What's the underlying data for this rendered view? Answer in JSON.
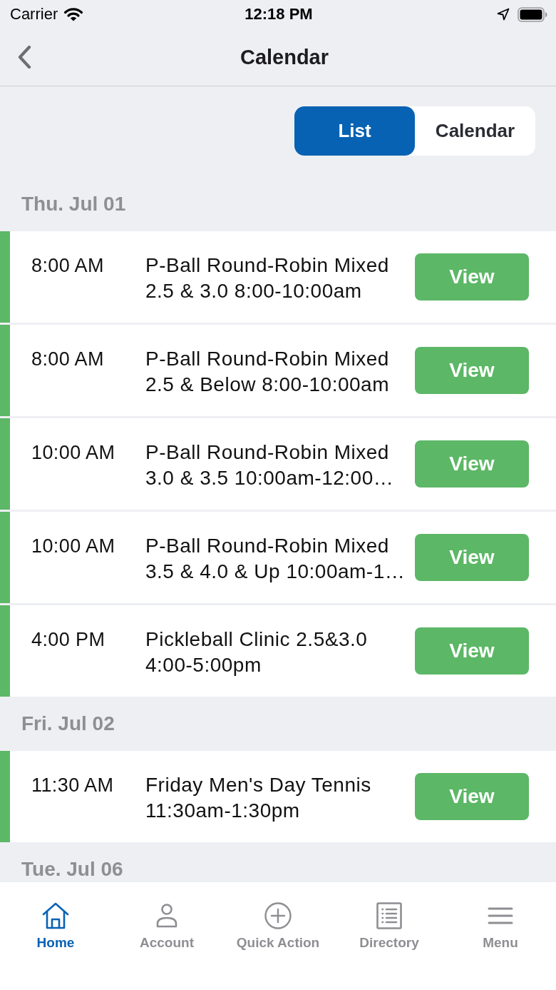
{
  "status_bar": {
    "carrier": "Carrier",
    "time": "12:18 PM"
  },
  "nav_bar": {
    "title": "Calendar"
  },
  "view_toggle": [
    {
      "label": "List",
      "selected": true
    },
    {
      "label": "Calendar",
      "selected": false
    }
  ],
  "sections": [
    {
      "date": "Thu. Jul 01",
      "events": [
        {
          "time": "8:00 AM",
          "title": "P-Ball Round-Robin Mixed\n2.5 & 3.0 8:00-10:00am",
          "button": "View"
        },
        {
          "time": "8:00 AM",
          "title": "P-Ball Round-Robin Mixed\n2.5 & Below 8:00-10:00am",
          "button": "View"
        },
        {
          "time": "10:00 AM",
          "title": "P-Ball Round-Robin Mixed\n3.0 & 3.5 10:00am-12:00…",
          "button": "View"
        },
        {
          "time": "10:00 AM",
          "title": "P-Ball Round-Robin Mixed\n3.5 & 4.0 & Up 10:00am-1…",
          "button": "View"
        },
        {
          "time": "4:00 PM",
          "title": "Pickleball Clinic 2.5&3.0\n4:00-5:00pm",
          "button": "View"
        }
      ]
    },
    {
      "date": "Fri. Jul 02",
      "events": [
        {
          "time": "11:30 AM",
          "title": "Friday Men's Day Tennis\n11:30am-1:30pm",
          "button": "View"
        }
      ]
    },
    {
      "date": "Tue. Jul 06"
    }
  ],
  "tab_bar": [
    {
      "label": "Home",
      "selected": true
    },
    {
      "label": "Account",
      "selected": false
    },
    {
      "label": "Quick Action",
      "selected": false
    },
    {
      "label": "Directory",
      "selected": false
    },
    {
      "label": "Menu",
      "selected": false
    }
  ]
}
